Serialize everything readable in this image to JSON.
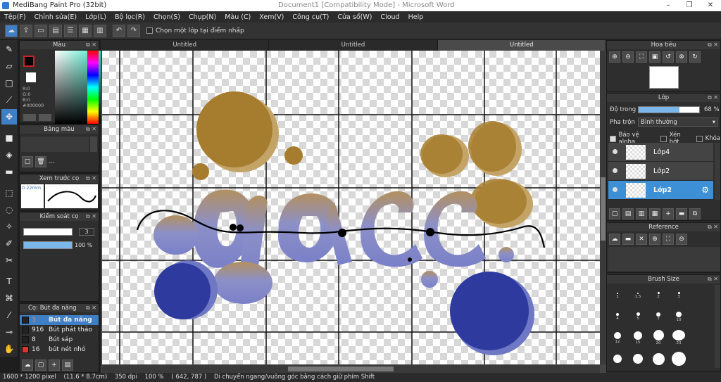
{
  "app": {
    "title": "MediBang Paint Pro (32bit)",
    "doc_title": "Document1 [Compatibility Mode] - Microsoft Word",
    "win_min": "–",
    "win_max": "❐",
    "win_close": "✕"
  },
  "menu": [
    "Tệp(F)",
    "Chỉnh sửa(E)",
    "Lớp(L)",
    "Bộ lọc(R)",
    "Chọn(S)",
    "Chụp(N)",
    "Màu (C)",
    "Xem(V)",
    "Công cụ(T)",
    "Cửa sổ(W)",
    "Cloud",
    "Help"
  ],
  "toolbar": {
    "option_label": "Chọn một lớp tại điểm nhấp"
  },
  "tabs": [
    "Untitled",
    "Untitled",
    "Untitled"
  ],
  "color_panel": {
    "title": "Màu",
    "r": "R:0",
    "g": "G:0",
    "b": "B:0",
    "hex": "#000000"
  },
  "swatch_panel": {
    "title": "Bảng màu",
    "dash": "---"
  },
  "preview_panel": {
    "title": "Xem trước cọ",
    "size": "0.22mm"
  },
  "control_panel": {
    "title": "Kiểm soát cọ",
    "size_value": "3",
    "opacity_value": "100 %"
  },
  "brush_panel": {
    "title": "Cọ: Bút đa năng",
    "items": [
      {
        "num": "3",
        "name": "Bút đa năng",
        "color": "#222222",
        "selected": true
      },
      {
        "num": "916",
        "name": "Bút phát thảo",
        "color": "#222222",
        "selected": false
      },
      {
        "num": "8",
        "name": "Bút sáp",
        "color": "#222222",
        "selected": false
      },
      {
        "num": "16",
        "name": "bút nét nhỏ",
        "color": "#e03030",
        "selected": false
      }
    ]
  },
  "navigator": {
    "title": "Hoa tiêu"
  },
  "layer_panel": {
    "title": "Lớp",
    "opacity_label": "Độ trong",
    "opacity_value": "68 %",
    "opacity_fraction": 0.68,
    "blend_label": "Pha trộn",
    "blend_value": "Bình thường",
    "protect_alpha": "Bảo vệ alpha",
    "clipping": "Xén bớt",
    "lock": "Khóa",
    "layers": [
      {
        "name": "Lớp4",
        "selected": false
      },
      {
        "name": "Lớp2",
        "selected": false
      },
      {
        "name": "Lớp2",
        "selected": true
      }
    ]
  },
  "reference_panel": {
    "title": "Reference"
  },
  "brushsize_panel": {
    "title": "Brush Size",
    "sizes": [
      "1",
      "1.5",
      "2",
      "3",
      "4",
      "5",
      "7",
      "10",
      "12",
      "15",
      "20",
      "23"
    ]
  },
  "status": {
    "size": "1600 * 1200 pixel",
    "cm": "(11.6 * 8.7cm)",
    "dpi": "350 dpi",
    "zoom": "100 %",
    "coords": "( 642, 787 )",
    "hint": "Di chuyển ngang/vuông góc bằng cách giữ phím Shift"
  },
  "colors": {
    "accent": "#3f7fc6",
    "bubble_gold": "#a67c2e",
    "letters_blue": "#7b83c8",
    "circle_navy": "#2e3a9e"
  }
}
